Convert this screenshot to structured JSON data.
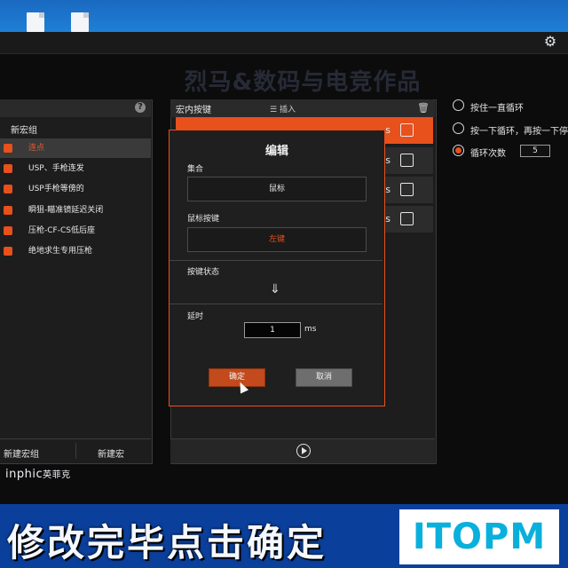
{
  "watermark": "烈马&数码与电竞作品",
  "left_panel": {
    "group_title": "新宏组",
    "items": [
      {
        "label": "连点",
        "selected": true
      },
      {
        "label": "USP、手枪连发",
        "selected": false
      },
      {
        "label": "USP手枪等傍的",
        "selected": false
      },
      {
        "label": "瞬狙-瞄准镜延迟关闭",
        "selected": false
      },
      {
        "label": "压枪-CF-CS低后座",
        "selected": false
      },
      {
        "label": "绝地求生专用压枪",
        "selected": false
      }
    ],
    "help": "?",
    "new_group": "新建宏组",
    "new_macro": "新建宏"
  },
  "logo": {
    "brand": "inphic",
    "cn": "英菲克"
  },
  "macro_panel": {
    "title": "宏内按键",
    "insert": "插入",
    "rows": [
      {
        "suffix": "s"
      },
      {
        "suffix": "s"
      },
      {
        "suffix": "s"
      },
      {
        "suffix": "s"
      }
    ]
  },
  "loop_options": {
    "opt1": "按住一直循环",
    "opt2": "按一下循环，再按一下停止",
    "opt3": "循环次数",
    "count": "5"
  },
  "dialog": {
    "title": "编辑",
    "set_label": "集合",
    "set_value": "鼠标",
    "key_label": "鼠标按键",
    "key_value": "左键",
    "state_label": "按键状态",
    "delay_label": "延时",
    "delay_value": "1",
    "delay_unit": "ms",
    "ok": "确定",
    "cancel": "取消"
  },
  "banner": {
    "text": "修改完毕点击确定",
    "logo": "ITOPM"
  },
  "colors": {
    "accent": "#e8501c",
    "banner": "#0a3f9b"
  }
}
